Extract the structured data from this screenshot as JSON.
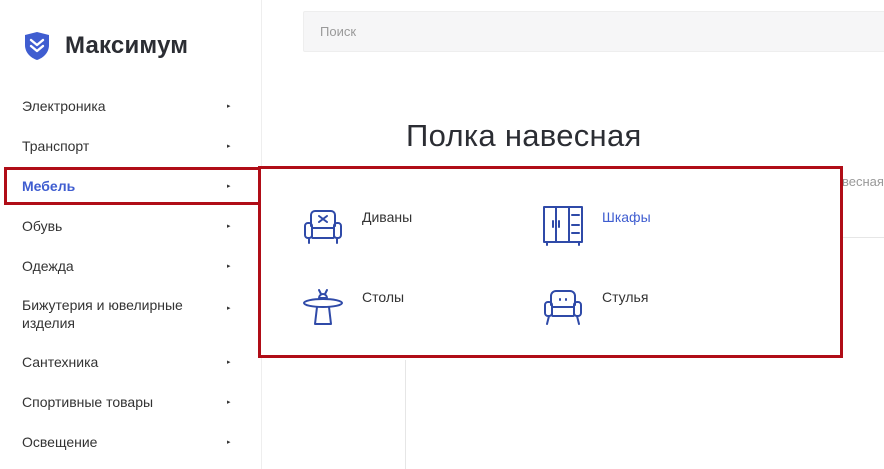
{
  "brand": {
    "name": "Максимум",
    "accent": "#3f5dd0",
    "highlight_outline": "#b00d17"
  },
  "search": {
    "placeholder": "Поиск"
  },
  "sidebar": {
    "items": [
      {
        "label": "Электроника",
        "arrow": "▸"
      },
      {
        "label": "Транспорт",
        "arrow": "▸"
      },
      {
        "label": "Мебель",
        "arrow": "▸"
      },
      {
        "label": "Обувь",
        "arrow": "▸"
      },
      {
        "label": "Одежда",
        "arrow": "▸"
      },
      {
        "label": "Бижутерия и ювелирные изделия",
        "arrow": "▸"
      },
      {
        "label": "Сантехника",
        "arrow": "▸"
      },
      {
        "label": "Спортивные товары",
        "arrow": "▸"
      },
      {
        "label": "Освещение",
        "arrow": "▸"
      }
    ]
  },
  "main": {
    "title": "Полка навесная",
    "breadcrumb_fragment": "весная"
  },
  "dropdown": {
    "items": [
      {
        "label": "Диваны",
        "icon": "sofa-icon"
      },
      {
        "label": "Шкафы",
        "icon": "wardrobe-icon"
      },
      {
        "label": "Столы",
        "icon": "table-icon"
      },
      {
        "label": "Стулья",
        "icon": "chair-icon"
      }
    ]
  }
}
